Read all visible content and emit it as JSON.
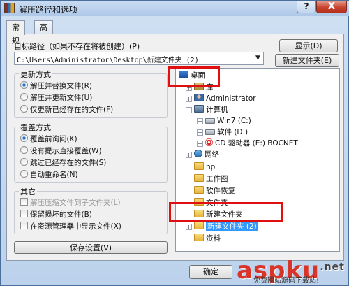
{
  "window": {
    "title": "解压路径和选项",
    "help_label": "?",
    "close_label": "X"
  },
  "tabs": [
    {
      "label": "常规",
      "active": true
    },
    {
      "label": "高级",
      "active": false
    }
  ],
  "target_path": {
    "label": "目标路径（如果不存在将被创建）(P)",
    "value": "C:\\Users\\Administrator\\Desktop\\新建文件夹 (2)",
    "show_button": "显示(D)",
    "new_folder_button": "新建文件夹(E)"
  },
  "update_mode": {
    "legend": "更新方式",
    "options": [
      {
        "label": "解压并替换文件(R)",
        "selected": true
      },
      {
        "label": "解压并更新文件(U)",
        "selected": false
      },
      {
        "label": "仅更新已经存在的文件(F)",
        "selected": false
      }
    ]
  },
  "overwrite_mode": {
    "legend": "覆盖方式",
    "options": [
      {
        "label": "覆盖前询问(K)",
        "selected": true
      },
      {
        "label": "没有提示直接覆盖(W)",
        "selected": false
      },
      {
        "label": "跳过已经存在的文件(S)",
        "selected": false
      },
      {
        "label": "自动重命名(N)",
        "selected": false
      }
    ]
  },
  "misc": {
    "legend": "其它",
    "options": [
      {
        "label": "解压压缩文件到子文件夹(L)",
        "checked": false,
        "disabled": true
      },
      {
        "label": "保留损坏的文件(B)",
        "checked": false,
        "disabled": false
      },
      {
        "label": "在资源管理器中显示文件(X)",
        "checked": false,
        "disabled": false
      }
    ]
  },
  "save_settings_button": "保存设置(V)",
  "tree": {
    "items": [
      {
        "label": "桌面",
        "icon": "desktop-icon"
      },
      {
        "label": "库",
        "icon": "library-icon"
      },
      {
        "label": "Administrator",
        "icon": "user-icon"
      },
      {
        "label": "计算机",
        "icon": "computer-icon"
      },
      {
        "label": "Win7 (C:)",
        "icon": "drive-icon"
      },
      {
        "label": "软件 (D:)",
        "icon": "drive-icon"
      },
      {
        "label": "CD 驱动器 (E:) BOCNET",
        "icon": "cd-icon"
      },
      {
        "label": "网络",
        "icon": "network-icon"
      },
      {
        "label": "hp",
        "icon": "folder-icon"
      },
      {
        "label": "工作图",
        "icon": "folder-icon"
      },
      {
        "label": "软件恢复",
        "icon": "folder-icon"
      },
      {
        "label": "文件夹",
        "icon": "folder-icon"
      },
      {
        "label": "新建文件夹",
        "icon": "folder-icon"
      },
      {
        "label": "新建文件夹 (2)",
        "icon": "folder-icon"
      },
      {
        "label": "资料",
        "icon": "folder-icon"
      }
    ]
  },
  "footer": {
    "ok_button": "确定"
  },
  "watermark": {
    "brand_a": "asp",
    "brand_b": "ku",
    "brand_tld": ".net",
    "sub": "免费网站源码下载站!"
  }
}
